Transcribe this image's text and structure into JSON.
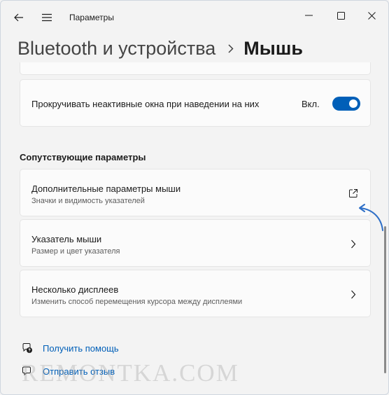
{
  "window": {
    "title": "Параметры"
  },
  "breadcrumb": {
    "parent": "Bluetooth и устройства",
    "current": "Мышь"
  },
  "scroll_inactive": {
    "label": "Прокручивать неактивные окна при наведении на них",
    "state": "Вкл.",
    "enabled": true
  },
  "related": {
    "heading": "Сопутствующие параметры",
    "items": [
      {
        "title": "Дополнительные параметры мыши",
        "subtitle": "Значки и видимость указателей",
        "action_icon": "external-link-icon"
      },
      {
        "title": "Указатель мыши",
        "subtitle": "Размер и цвет указателя",
        "action_icon": "chevron-right-icon"
      },
      {
        "title": "Несколько дисплеев",
        "subtitle": "Изменить способ перемещения курсора между дисплеями",
        "action_icon": "chevron-right-icon"
      }
    ]
  },
  "footer": {
    "help": "Получить помощь",
    "feedback": "Отправить отзыв"
  },
  "watermark": "REMONTKA.COM",
  "colors": {
    "accent": "#005fb8",
    "background": "#f3f3f3",
    "card": "#fbfbfb",
    "annotation_arrow": "#2e6fc7"
  }
}
